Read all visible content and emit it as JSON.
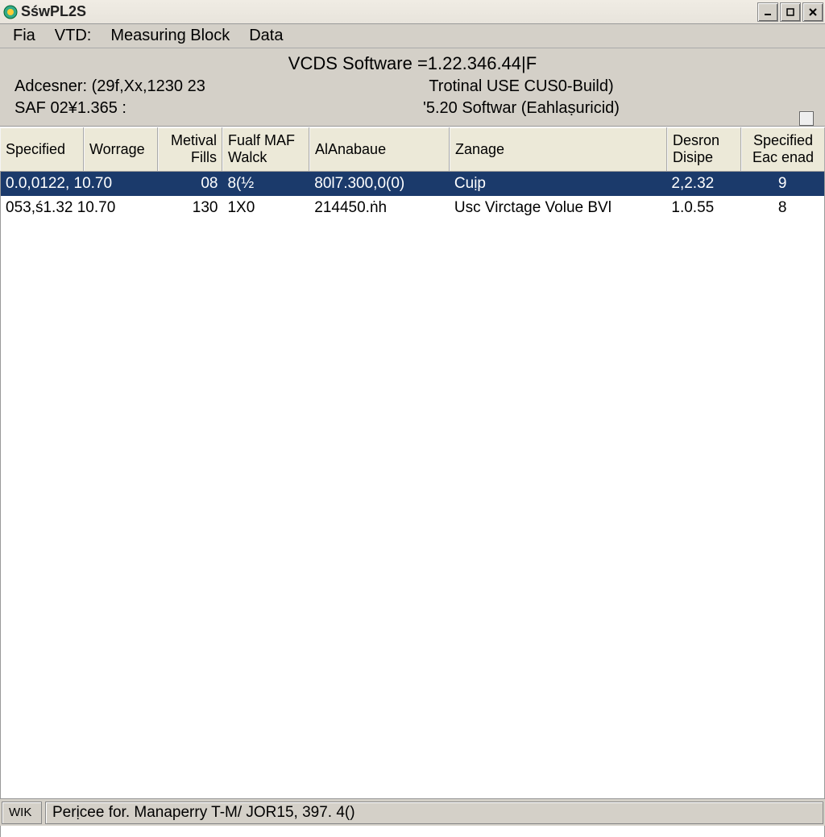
{
  "titlebar": {
    "title": "SśwPL2S"
  },
  "menubar": {
    "items": [
      "Fia",
      "VTD:",
      "Measuring Block",
      "Data"
    ]
  },
  "info": {
    "line1": "VCDS Software =1.22.346.44|F",
    "line2_left": "Adcesner: (29f,Xx,1230    23",
    "line2_center": "Trotinal USE CUS0-Build)",
    "line3_left": "SAF 02¥1.365           :",
    "line3_center": "'5.20 Softwar (Eahlaṣuricid)"
  },
  "columns": [
    {
      "l1": "Specified",
      "l2": ""
    },
    {
      "l1": "",
      "l2": "Worrage"
    },
    {
      "l1": "Metival",
      "l2": "Fills"
    },
    {
      "l1": "Fualf MAF",
      "l2": "Walck"
    },
    {
      "l1": "",
      "l2": "AlAnabaue"
    },
    {
      "l1": "",
      "l2": "Zanage"
    },
    {
      "l1": "Desron",
      "l2": "Disipe"
    },
    {
      "l1": "Specified",
      "l2": "Eac enad"
    }
  ],
  "rows": [
    {
      "selected": true,
      "c0c1": "0.0,0122, 10.70",
      "c2": "08",
      "c3": "8(½",
      "c4": "80l7.300,0(0)",
      "c5": "Cuịp",
      "c6": "2,2.32",
      "c7": "9"
    },
    {
      "selected": false,
      "c0c1": "053,ś1.32 10.70",
      "c2": "130",
      "c3": "1X0",
      "c4": "214450.ṅh",
      "c5": "Usc Virctage Volue BVl",
      "c6": "1.0.55",
      "c7": "8"
    }
  ],
  "statusbar": {
    "left": "WIK",
    "main": "Perịcee for. Manaperry T-M/ JOR15, 397. 4()"
  },
  "window_controls": {
    "minimize": "_",
    "maximize": "☐",
    "close": "✕"
  }
}
